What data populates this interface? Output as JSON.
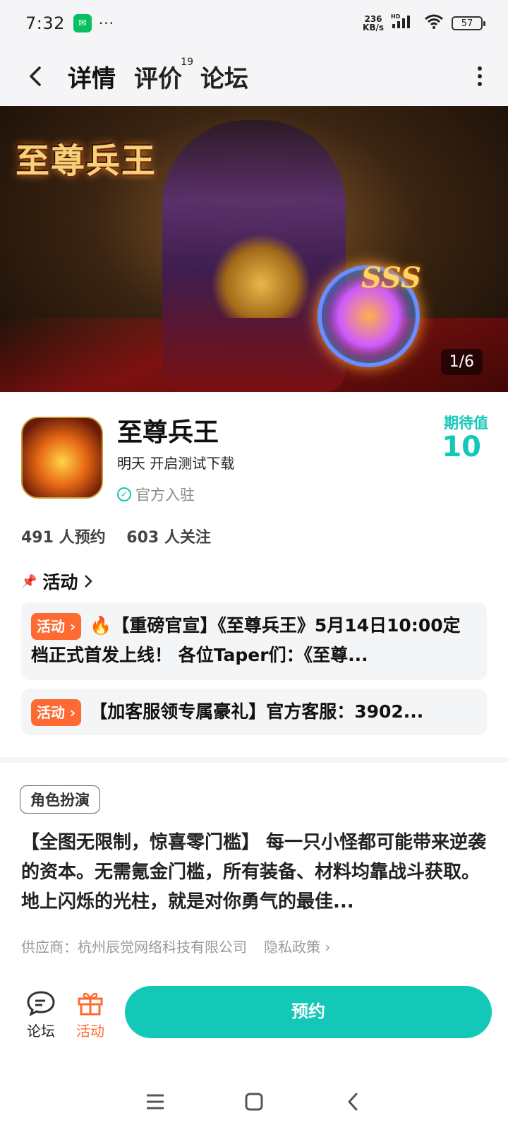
{
  "status_bar": {
    "time": "7:32",
    "wechat_icon": "wechat-icon",
    "dots": "···",
    "net_speed_top": "236",
    "net_speed_bottom": "KB/s",
    "signal_label": "HD",
    "battery": "57"
  },
  "nav": {
    "tabs": [
      {
        "label": "详情",
        "active": true
      },
      {
        "label": "评价",
        "badge": "19"
      },
      {
        "label": "论坛"
      }
    ]
  },
  "banner": {
    "logo_text": "至尊兵王",
    "badge": "SSS",
    "counter": "1/6"
  },
  "app": {
    "name": "至尊兵王",
    "status": "明天 开启测试下载",
    "official": "官方入驻",
    "expect_label": "期待值",
    "expect_value": "10",
    "reservations": "491 人预约",
    "followers": "603 人关注"
  },
  "activities": {
    "title": "活动",
    "items": [
      {
        "tag": "活动",
        "text": "🔥【重磅官宣】《至尊兵王》5月14日10:00定档正式首发上线！ 各位Taper们：《至尊..."
      },
      {
        "tag": "活动",
        "text": "【加客服领专属豪礼】官方客服：3902..."
      }
    ]
  },
  "details": {
    "genre": "角色扮演",
    "description": "【全图无限制，惊喜零门槛】 每一只小怪都可能带来逆袭的资本。无需氪金门槛，所有装备、材料均靠战斗获取。地上闪烁的光柱，就是对你勇气的最佳...",
    "supplier": "供应商：杭州辰觉网络科技有限公司",
    "privacy": "隐私政策"
  },
  "bottom_bar": {
    "forum": "论坛",
    "activity": "活动",
    "reserve": "预约"
  },
  "colors": {
    "accent": "#14c8b8",
    "activity_tag": "#ff6a32"
  }
}
